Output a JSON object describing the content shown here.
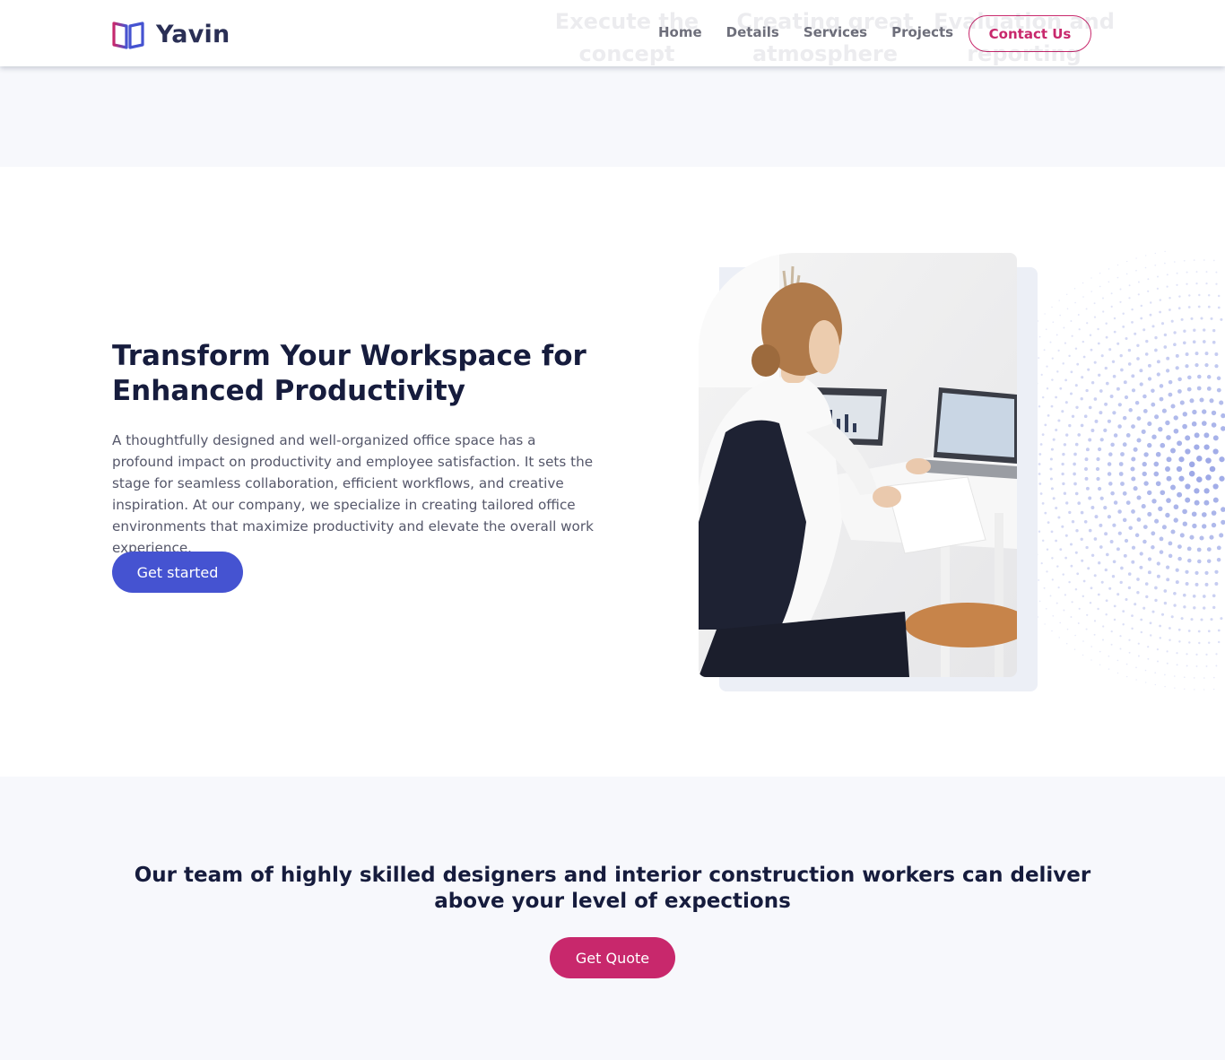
{
  "brand": {
    "name": "Yavin",
    "logo_icon": "book-icon",
    "colors": {
      "pink": "#c8286c",
      "blue": "#4553d1",
      "navy": "#161c3d"
    }
  },
  "nav": {
    "items": [
      "Home",
      "Details",
      "Services",
      "Projects"
    ],
    "contact_label": "Contact Us"
  },
  "ghost_headings": [
    "Execute the concept",
    "Creating great atmosphere",
    "Evaluation and reporting"
  ],
  "hero": {
    "title": "Transform Your Workspace for Enhanced Productivity",
    "text": "A thoughtfully designed and well-organized office space has a profound impact on productivity and employee satisfaction. It sets the stage for seamless collaboration, efficient workflows, and creative inspiration. At our company, we specialize in creating tailored office environments that maximize productivity and elevate the overall work experience.",
    "button_label": "Get started",
    "image_icon": "woman-at-laptop-photo"
  },
  "cta": {
    "title": "Our team of highly skilled designers and interior construction workers can deliver above your level of expections",
    "button_label": "Get Quote"
  }
}
